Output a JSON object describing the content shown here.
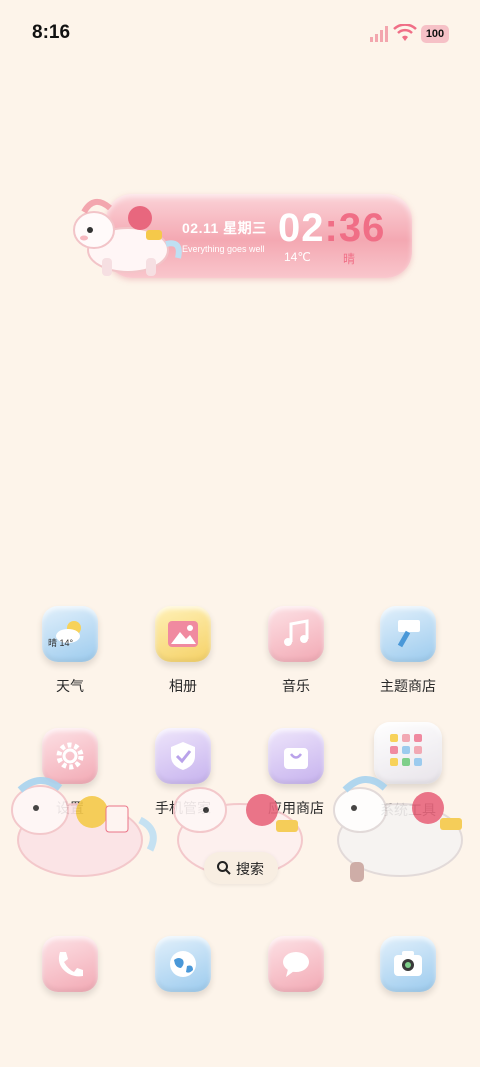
{
  "status": {
    "time": "8:16",
    "battery": "100"
  },
  "widget": {
    "date": "02.11 星期三",
    "tagline": "Everything goes well",
    "hour": "02",
    "minute": ":36",
    "temp": "14℃",
    "condition": "晴"
  },
  "apps": [
    {
      "label": "天气",
      "weather_text": "晴 14°"
    },
    {
      "label": "相册"
    },
    {
      "label": "音乐"
    },
    {
      "label": "主题商店"
    },
    {
      "label": "设置"
    },
    {
      "label": "手机管家"
    },
    {
      "label": "应用商店"
    },
    {
      "label": "系统工具"
    }
  ],
  "search": {
    "label": "搜索"
  },
  "colors": {
    "background": "#fdf4ea",
    "accent_pink": "#f06e86",
    "widget_pink": "#f4a8b2"
  }
}
